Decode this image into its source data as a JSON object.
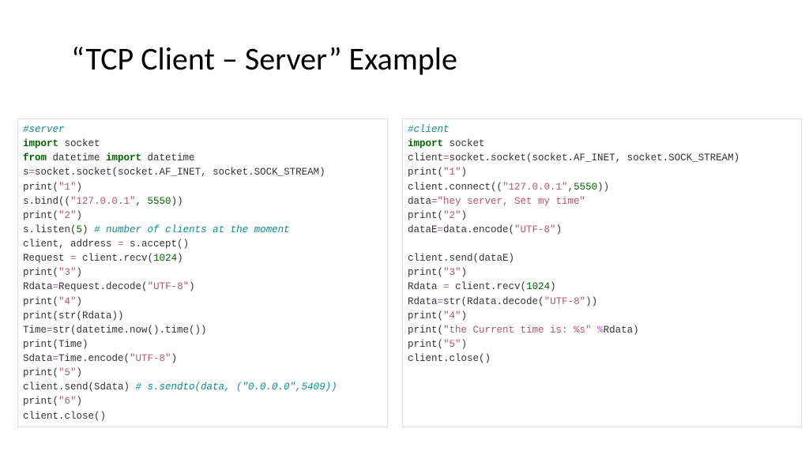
{
  "title": "“TCP Client – Server” Example",
  "server": {
    "comment": "#server",
    "l01a": "import",
    "l01b": " socket",
    "l02a": "from",
    "l02b": " datetime ",
    "l02c": "import",
    "l02d": " datetime",
    "l03a": "s",
    "l03b": "=",
    "l03c": "socket.socket(socket.AF_INET, socket.SOCK_STREAM)",
    "l04a": "print(",
    "l04b": "\"1\"",
    "l04c": ")",
    "l05a": "s.bind((",
    "l05b": "\"127.0.0.1\"",
    "l05c": ", ",
    "l05d": "5550",
    "l05e": "))",
    "l06a": "print(",
    "l06b": "\"2\"",
    "l06c": ")",
    "l07a": "s.listen(",
    "l07b": "5",
    "l07c": ") ",
    "l07d": "# number of clients at the moment",
    "l08a": "client, address ",
    "l08b": "=",
    "l08c": " s.accept()",
    "l09a": "Request ",
    "l09b": "=",
    "l09c": " client.recv(",
    "l09d": "1024",
    "l09e": ")",
    "l10a": "print(",
    "l10b": "\"3\"",
    "l10c": ")",
    "l11a": "Rdata",
    "l11b": "=",
    "l11c": "Request.decode(",
    "l11d": "\"UTF-8\"",
    "l11e": ")",
    "l12a": "print(",
    "l12b": "\"4\"",
    "l12c": ")",
    "l13a": "print(str(Rdata))",
    "l14a": "Time",
    "l14b": "=",
    "l14c": "str(datetime.now().time())",
    "l15a": "print(Time)",
    "l16a": "Sdata",
    "l16b": "=",
    "l16c": "Time.encode(",
    "l16d": "\"UTF-8\"",
    "l16e": ")",
    "l17a": "print(",
    "l17b": "\"5\"",
    "l17c": ")",
    "l18a": "client.send(Sdata) ",
    "l18b": "# s.sendto(data, (\"0.0.0.0\",5409))",
    "l19a": "print(",
    "l19b": "\"6\"",
    "l19c": ")",
    "l20a": "client.close()"
  },
  "client": {
    "comment": "#client",
    "l01a": "import",
    "l01b": " socket",
    "l02a": "client",
    "l02b": "=",
    "l02c": "socket.socket(socket.AF_INET, socket.SOCK_STREAM)",
    "l03a": "print(",
    "l03b": "\"1\"",
    "l03c": ")",
    "l04a": "client.connect((",
    "l04b": "\"127.0.0.1\"",
    "l04c": ",",
    "l04d": "5550",
    "l04e": "))",
    "l05a": "data",
    "l05b": "=",
    "l05c": "\"hey server, Set my time\"",
    "l06a": "print(",
    "l06b": "\"2\"",
    "l06c": ")",
    "l07a": "dataE",
    "l07b": "=",
    "l07c": "data.encode(",
    "l07d": "\"UTF-8\"",
    "l07e": ")",
    "blank": "",
    "l08a": "client.send(dataE)",
    "l09a": "print(",
    "l09b": "\"3\"",
    "l09c": ")",
    "l10a": "Rdata ",
    "l10b": "=",
    "l10c": " client.recv(",
    "l10d": "1024",
    "l10e": ")",
    "l11a": "Rdata",
    "l11b": "=",
    "l11c": "str(Rdata.decode(",
    "l11d": "\"UTF-8\"",
    "l11e": "))",
    "l12a": "print(",
    "l12b": "\"4\"",
    "l12c": ")",
    "l13a": "print(",
    "l13b": "\"the Current time is: %s\"",
    "l13c": " ",
    "l13d": "%",
    "l13e": "Rdata)",
    "l14a": "print(",
    "l14b": "\"5\"",
    "l14c": ")",
    "l15a": "client.close()"
  }
}
